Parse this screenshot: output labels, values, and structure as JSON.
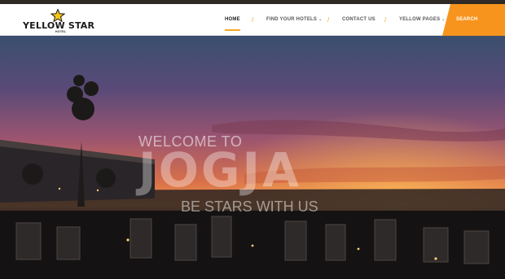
{
  "brand": {
    "name": "YELLOW STAR",
    "sub": "HOTEL",
    "accent_color": "#f5a623"
  },
  "nav": {
    "items": [
      {
        "label": "HOME",
        "active": true
      },
      {
        "label": "FIND YOUR HOTELS",
        "dropdown": true
      },
      {
        "label": "CONTACT US"
      },
      {
        "label": "YELLOW PAGES",
        "dropdown": true
      }
    ],
    "separator": "/",
    "search_label": "SEARCH",
    "search_color": "#f7941d"
  },
  "hero": {
    "welcome": "WELCOME TO",
    "title": "JOGJA",
    "tagline": "BE STARS WITH US"
  },
  "icons": {
    "logo": "star-icon",
    "dropdown": "chevron-down-icon"
  }
}
